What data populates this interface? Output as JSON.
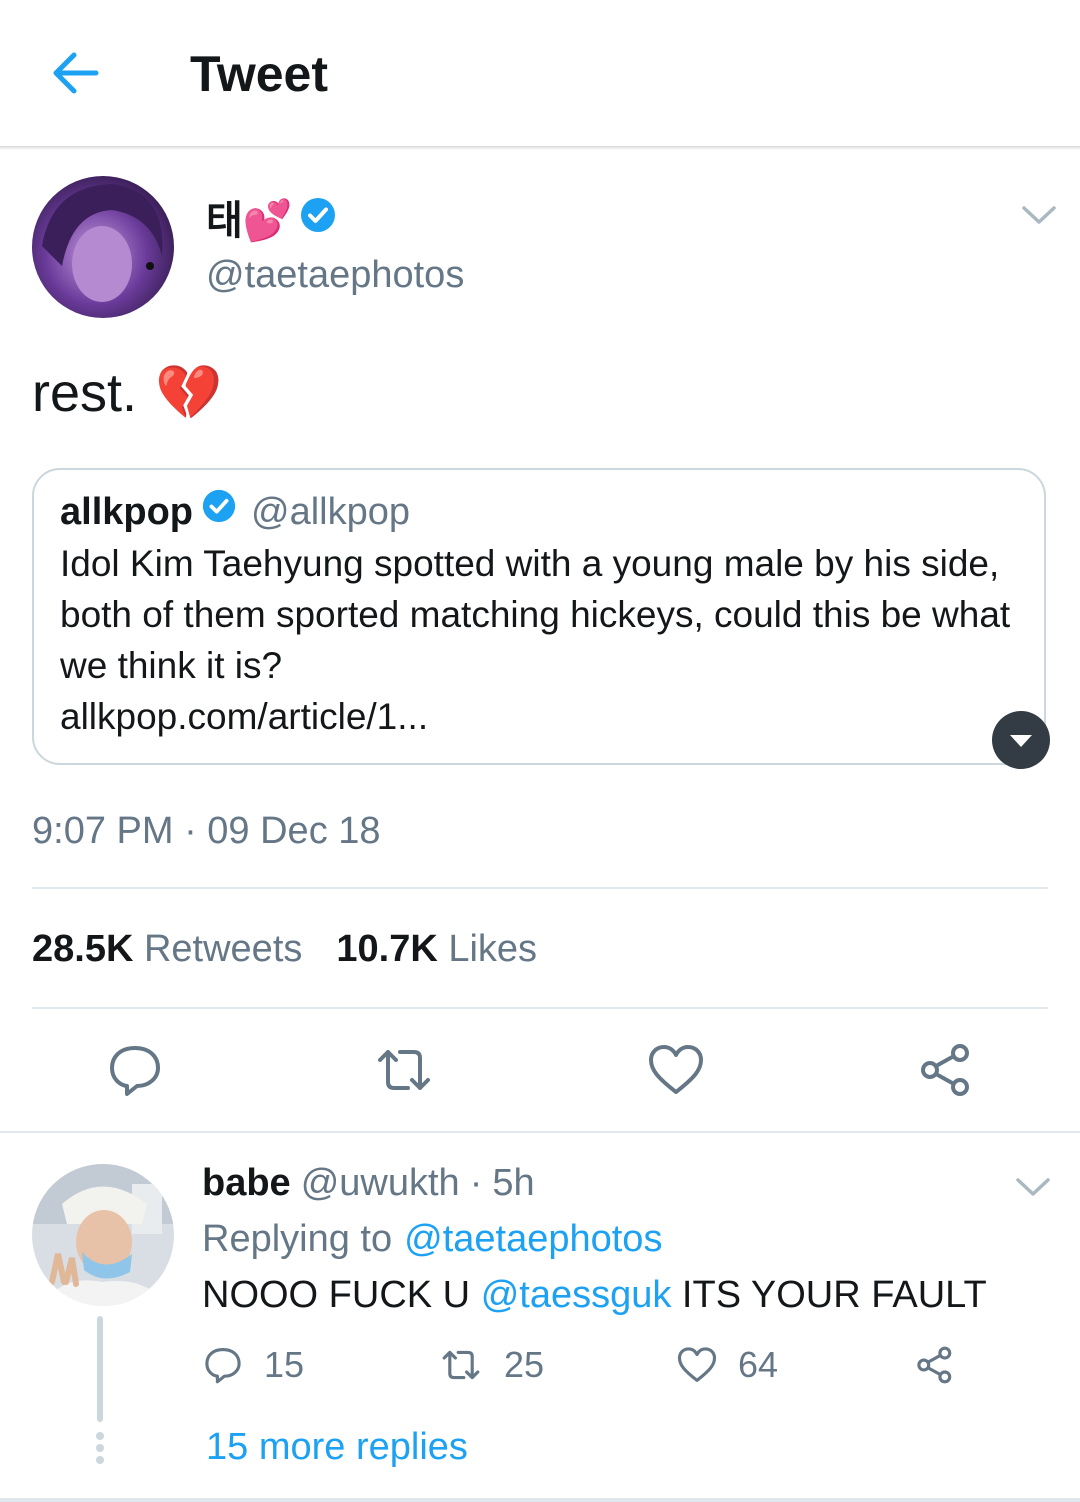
{
  "header": {
    "title": "Tweet",
    "back_icon": "arrow-left-icon",
    "accent": "#1da1f2"
  },
  "tweet": {
    "author_name": "태💕",
    "author_handle": "@taetaephotos",
    "verified": true,
    "text": "rest.",
    "emoji": "💔",
    "timestamp": "9:07 PM · 09 Dec 18",
    "stats": {
      "retweets_count": "28.5K",
      "retweets_label": "Retweets",
      "likes_count": "10.7K",
      "likes_label": "Likes"
    },
    "quote": {
      "name": "allkpop",
      "handle": "@allkpop",
      "verified": true,
      "text": "Idol Kim Taehyung spotted with a young male by his side, both of them sported matching hickeys, could this be what we think it is?",
      "link": "allkpop.com/article/1..."
    },
    "actions": [
      "reply-icon",
      "retweet-icon",
      "like-icon",
      "share-icon"
    ]
  },
  "reply": {
    "name": "babe",
    "handle": "@uwukth",
    "separator": "·",
    "time": "5h",
    "replying_label": "Replying to",
    "replying_handle": "@taetaephotos",
    "text_before": "NOOO FUCK U",
    "mention": "@taessguk",
    "text_after": "ITS YOUR FAULT",
    "reply_count": "15",
    "retweet_count": "25",
    "like_count": "64",
    "more_replies": "15 more replies"
  },
  "colors": {
    "text": "#14171a",
    "secondary": "#657786",
    "link": "#1da1f2",
    "divider": "#e1e8ed",
    "verified": "#1da1f2"
  }
}
